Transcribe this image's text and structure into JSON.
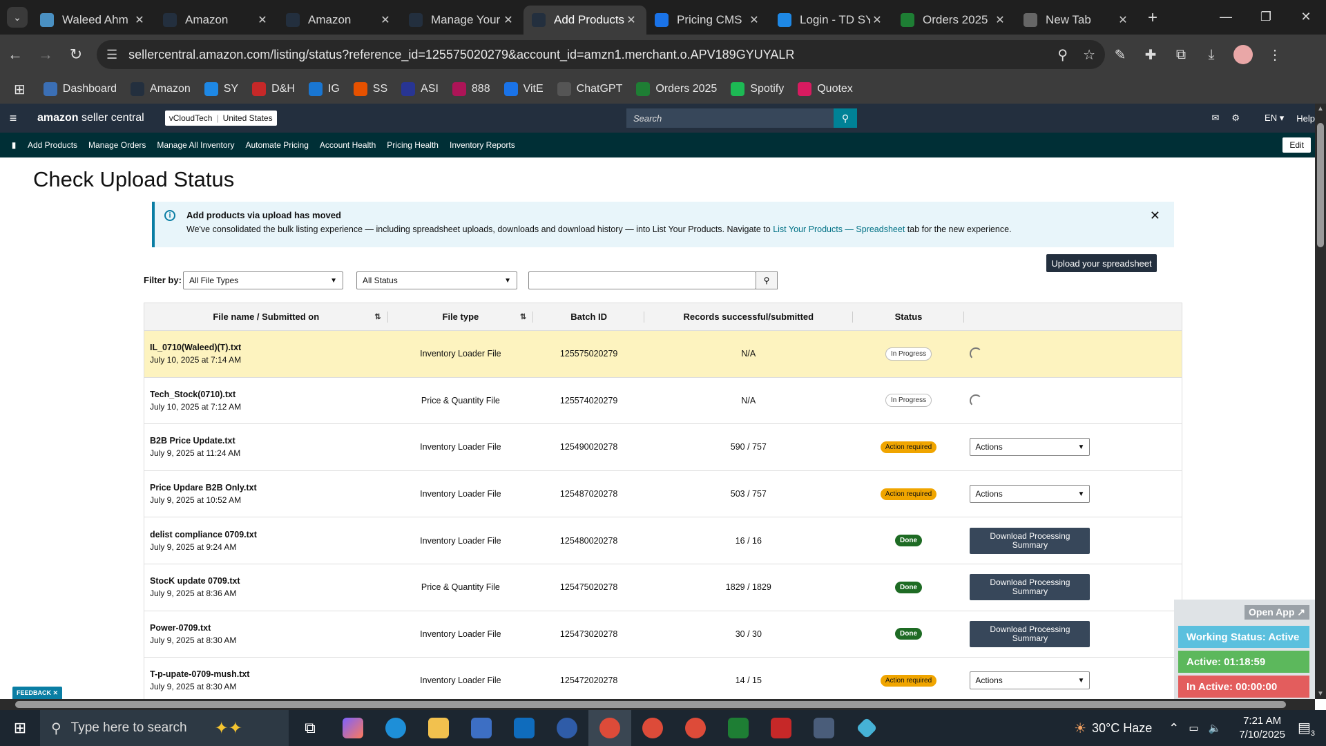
{
  "browser": {
    "tabs": [
      {
        "title": "Waleed Ahm",
        "icon": "waleed-app-icon",
        "color": "#4a90c2",
        "active": false
      },
      {
        "title": "Amazon",
        "icon": "amazon-icon",
        "color": "#232f3e",
        "active": false
      },
      {
        "title": "Amazon",
        "icon": "amazon-icon",
        "color": "#232f3e",
        "active": false
      },
      {
        "title": "Manage Your",
        "icon": "amazon-icon",
        "color": "#232f3e",
        "active": false
      },
      {
        "title": "Add Products",
        "icon": "amazon-icon",
        "color": "#232f3e",
        "active": true
      },
      {
        "title": "Pricing CMS",
        "icon": "dollar-icon",
        "color": "#1a73e8",
        "active": false
      },
      {
        "title": "Login - TD SY",
        "icon": "ec-icon",
        "color": "#1e88e5",
        "active": false
      },
      {
        "title": "Orders 2025",
        "icon": "sheets-icon",
        "color": "#1e7e34",
        "active": false
      },
      {
        "title": "New Tab",
        "icon": "chrome-icon",
        "color": "#666666",
        "active": false
      }
    ],
    "url": "sellercentral.amazon.com/listing/status?reference_id=125575020279&account_id=amzn1.merchant.o.APV189GYUYALR",
    "bookmarks": [
      {
        "label": "Dashboard",
        "color": "#3b6fb5"
      },
      {
        "label": "Amazon",
        "color": "#232f3e"
      },
      {
        "label": "SY",
        "color": "#1e88e5"
      },
      {
        "label": "D&H",
        "color": "#c62828"
      },
      {
        "label": "IG",
        "color": "#1976d2"
      },
      {
        "label": "SS",
        "color": "#e65100"
      },
      {
        "label": "ASI",
        "color": "#283593"
      },
      {
        "label": "888",
        "color": "#ad1457"
      },
      {
        "label": "VitE",
        "color": "#1a73e8"
      },
      {
        "label": "ChatGPT",
        "color": "#555555"
      },
      {
        "label": "Orders 2025",
        "color": "#1e7e34"
      },
      {
        "label": "Spotify",
        "color": "#1db954"
      },
      {
        "label": "Quotex",
        "color": "#d81b60"
      }
    ]
  },
  "seller": {
    "logo_bold": "amazon",
    "logo_rest": " seller central",
    "account": "vCloudTech",
    "region": "United States",
    "search_placeholder": "Search",
    "lang": "EN",
    "help": "Help",
    "nav": [
      "Add Products",
      "Manage Orders",
      "Manage All Inventory",
      "Automate Pricing",
      "Account Health",
      "Pricing Health",
      "Inventory Reports"
    ],
    "edit": "Edit"
  },
  "page": {
    "title": "Check Upload Status",
    "banner_title": "Add products via upload has moved",
    "banner_text": "We've consolidated the bulk listing experience — including spreadsheet uploads, downloads and download history — into List Your Products. Navigate to ",
    "banner_link": "List Your Products — Spreadsheet",
    "banner_tail": " tab for the new experience.",
    "upload_button": "Upload your spreadsheet",
    "filter_label": "Filter by:",
    "file_type_filter": "All File Types",
    "status_filter": "All Status",
    "search_value": "",
    "columns": [
      "File name / Submitted on",
      "File type",
      "Batch ID",
      "Records successful/submitted",
      "Status",
      ""
    ],
    "rows": [
      {
        "name": "IL_0710(Waleed)(T).txt",
        "date": "July 10, 2025 at 7:14 AM",
        "type": "Inventory Loader File",
        "batch": "125575020279",
        "records": "N/A",
        "status": "In Progress",
        "kind": "prog",
        "action": "spinner",
        "highlight": true
      },
      {
        "name": "Tech_Stock(0710).txt",
        "date": "July 10, 2025 at 7:12 AM",
        "type": "Price & Quantity File",
        "batch": "125574020279",
        "records": "N/A",
        "status": "In Progress",
        "kind": "prog",
        "action": "spinner",
        "highlight": false
      },
      {
        "name": "B2B Price Update.txt",
        "date": "July 9, 2025 at 11:24 AM",
        "type": "Inventory Loader File",
        "batch": "125490020278",
        "records": "590 / 757",
        "status": "Action required",
        "kind": "act",
        "action": "Actions",
        "highlight": false
      },
      {
        "name": "Price Updare B2B Only.txt",
        "date": "July 9, 2025 at 10:52 AM",
        "type": "Inventory Loader File",
        "batch": "125487020278",
        "records": "503 / 757",
        "status": "Action required",
        "kind": "act",
        "action": "Actions",
        "highlight": false
      },
      {
        "name": "delist compliance 0709.txt",
        "date": "July 9, 2025 at 9:24 AM",
        "type": "Inventory Loader File",
        "batch": "125480020278",
        "records": "16 / 16",
        "status": "Done",
        "kind": "done",
        "action": "Download Processing Summary",
        "highlight": false
      },
      {
        "name": "StocK update 0709.txt",
        "date": "July 9, 2025 at 8:36 AM",
        "type": "Price & Quantity File",
        "batch": "125475020278",
        "records": "1829 / 1829",
        "status": "Done",
        "kind": "done",
        "action": "Download Processing Summary",
        "highlight": false
      },
      {
        "name": "Power-0709.txt",
        "date": "July 9, 2025 at 8:30 AM",
        "type": "Inventory Loader File",
        "batch": "125473020278",
        "records": "30 / 30",
        "status": "Done",
        "kind": "done",
        "action": "Download Processing Summary",
        "highlight": false
      },
      {
        "name": "T-p-upate-0709-mush.txt",
        "date": "July 9, 2025 at 8:30 AM",
        "type": "Inventory Loader File",
        "batch": "125472020278",
        "records": "14 / 15",
        "status": "Action required",
        "kind": "act",
        "action": "Actions",
        "highlight": false
      }
    ],
    "feedback": "FEEDBACK"
  },
  "widget": {
    "open_app": "Open App ↗",
    "working": "Working Status: Active",
    "active": "Active: 01:18:59",
    "inactive": "In Active: 00:00:00",
    "colors": {
      "working": "#5bc0de",
      "active": "#5cb85c",
      "inactive": "#e35d5d"
    }
  },
  "taskbar": {
    "search_placeholder": "Type here to search",
    "weather": "30°C Haze",
    "time": "7:21 AM",
    "date": "7/10/2025",
    "notifications": "3"
  }
}
